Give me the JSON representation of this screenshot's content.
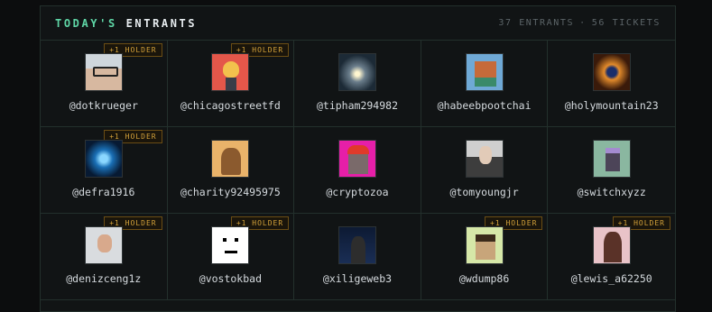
{
  "header": {
    "title_part1": "TODAY'S",
    "title_part2": "ENTRANTS",
    "entrants": "37 ENTRANTS",
    "separator": "·",
    "tickets": "56 TICKETS"
  },
  "badge_label": "+1 HOLDER",
  "entrants": [
    {
      "handle": "@dotkrueger",
      "holder": true,
      "avatar": "av-face"
    },
    {
      "handle": "@chicagostreetfd",
      "holder": true,
      "avatar": "av-fox"
    },
    {
      "handle": "@tipham294982",
      "holder": false,
      "avatar": "av-tree"
    },
    {
      "handle": "@habeebpootchai",
      "holder": false,
      "avatar": "av-pixelfox"
    },
    {
      "handle": "@holymountain23",
      "holder": false,
      "avatar": "av-eye"
    },
    {
      "handle": "@defra1916",
      "holder": true,
      "avatar": "av-robot"
    },
    {
      "handle": "@charity92495975",
      "holder": false,
      "avatar": "av-bear"
    },
    {
      "handle": "@cryptozoa",
      "holder": false,
      "avatar": "av-ape"
    },
    {
      "handle": "@tomyoungjr",
      "holder": false,
      "avatar": "av-old"
    },
    {
      "handle": "@switchxyzz",
      "holder": false,
      "avatar": "av-punk"
    },
    {
      "handle": "@denizceng1z",
      "holder": true,
      "avatar": "av-man"
    },
    {
      "handle": "@vostokbad",
      "holder": true,
      "avatar": "av-mark"
    },
    {
      "handle": "@xiligeweb3",
      "holder": false,
      "avatar": "av-speaker"
    },
    {
      "handle": "@wdump86",
      "holder": true,
      "avatar": "av-pixel2"
    },
    {
      "handle": "@lewis_a62250",
      "holder": true,
      "avatar": "av-girl"
    }
  ]
}
